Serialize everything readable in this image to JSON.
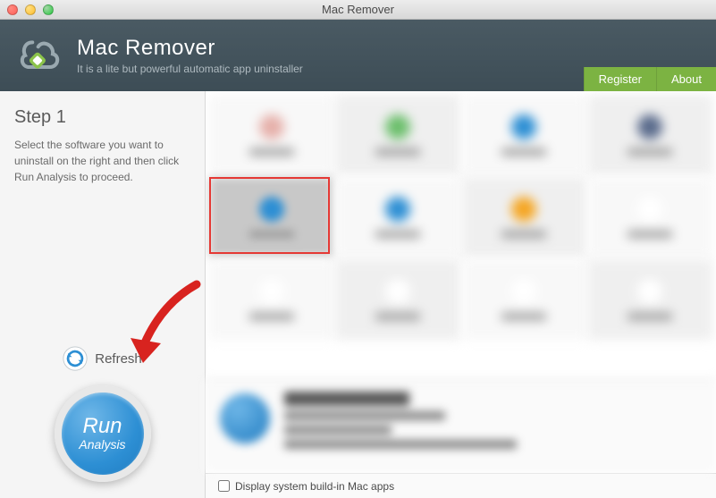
{
  "window": {
    "title": "Mac Remover"
  },
  "header": {
    "app_title": "Mac Remover",
    "subtitle": "It is a lite but powerful automatic app uninstaller",
    "register_label": "Register",
    "about_label": "About"
  },
  "sidebar": {
    "step_title": "Step 1",
    "step_desc": "Select the software you want to uninstall on the right and then click Run Analysis to proceed.",
    "refresh_label": "Refresh",
    "run_line1": "Run",
    "run_line2": "Analysis"
  },
  "grid": {
    "selected_index": 4,
    "cells": [
      {
        "icon_color": "#e6b0aa"
      },
      {
        "icon_color": "#6cbf6c"
      },
      {
        "icon_color": "#2d8fd4"
      },
      {
        "icon_color": "#5a6b8c"
      },
      {
        "icon_color": "#2d8fd4"
      },
      {
        "icon_color": "#2d8fd4"
      },
      {
        "icon_color": "#f5a623"
      },
      {
        "icon_color": "#ffffff"
      },
      {
        "icon_color": "#ffffff"
      },
      {
        "icon_color": "#ffffff"
      },
      {
        "icon_color": "#ffffff"
      },
      {
        "icon_color": "#ffffff"
      }
    ]
  },
  "footer": {
    "checkbox_label": "Display system build-in Mac apps",
    "checked": false
  },
  "colors": {
    "accent_green": "#7cb342",
    "accent_blue": "#2d8fd4",
    "arrow_red": "#d8231f"
  }
}
